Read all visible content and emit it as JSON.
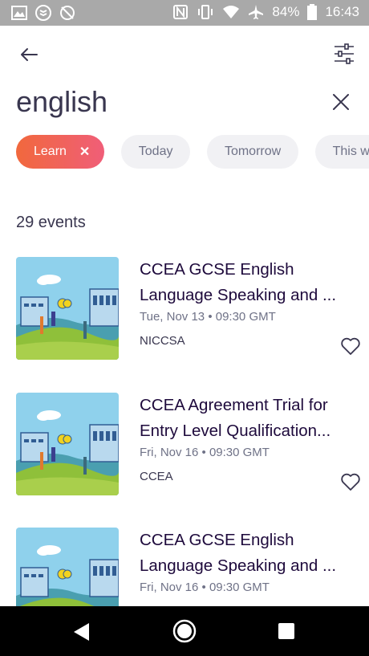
{
  "status_bar": {
    "battery": "84%",
    "time": "16:43",
    "left_icons": [
      "gallery-icon",
      "dropbox-icon",
      "sync-off-icon"
    ],
    "right_icons": [
      "nfc-icon",
      "vibrate-icon",
      "wifi-icon",
      "airplane-icon",
      "battery-icon"
    ]
  },
  "search": {
    "query": "english"
  },
  "chips": [
    {
      "label": "Learn",
      "active": true
    },
    {
      "label": "Today",
      "active": false
    },
    {
      "label": "Tomorrow",
      "active": false
    },
    {
      "label": "This w",
      "active": false
    }
  ],
  "results": {
    "count_label": "29 events",
    "events": [
      {
        "title": "CCEA GCSE English Language Speaking and ...",
        "date": "Tue, Nov 13 • 09:30 GMT",
        "organizer": "NICCSA"
      },
      {
        "title": "CCEA Agreement Trial for Entry Level Qualification...",
        "date": "Fri, Nov 16 • 09:30 GMT",
        "organizer": "CCEA"
      },
      {
        "title": "CCEA GCSE English Language Speaking and ...",
        "date": "Fri, Nov 16 • 09:30 GMT",
        "organizer": ""
      }
    ]
  },
  "colors": {
    "accent_start": "#f1683d",
    "accent_end": "#f05e78",
    "status_bar": "#a9a9a9",
    "nav_bar": "#000000"
  }
}
